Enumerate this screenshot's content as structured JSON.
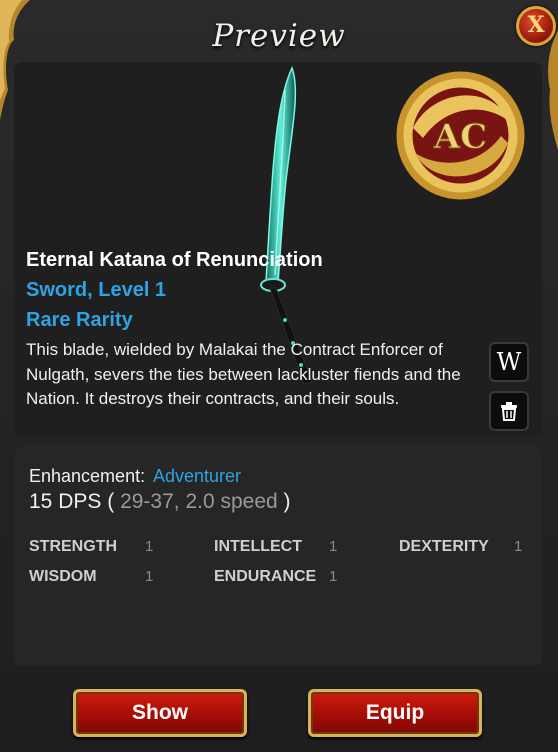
{
  "window": {
    "title": "Preview",
    "close_label": "X"
  },
  "item": {
    "name": "Eternal Katana of Renunciation",
    "type_level": "Sword, Level 1",
    "rarity": "Rare Rarity",
    "description": "This blade, wielded by Malakai the Contract Enforcer of Nulgath, severs the ties between lackluster fiends and the Nation. It destroys their contracts, and their souls.",
    "currency_badge": "AC"
  },
  "side_buttons": {
    "wiki_label": "W",
    "trash_icon": "trash-icon"
  },
  "enhancement": {
    "label": "Enhancement:",
    "value": "Adventurer",
    "dps_value": "15 DPS",
    "range": "29-37, 2.0 speed",
    "open_paren": "(",
    "close_paren": ")"
  },
  "stats": [
    {
      "name": "STRENGTH",
      "value": "1"
    },
    {
      "name": "INTELLECT",
      "value": "1"
    },
    {
      "name": "DEXTERITY",
      "value": "1"
    },
    {
      "name": "WISDOM",
      "value": "1"
    },
    {
      "name": "ENDURANCE",
      "value": "1"
    }
  ],
  "actions": {
    "show_label": "Show",
    "equip_label": "Equip"
  },
  "colors": {
    "accent_blue": "#2ea3e3",
    "button_red": "#b8120a",
    "gold": "#d7b45c",
    "panel": "#1f1f1f"
  }
}
